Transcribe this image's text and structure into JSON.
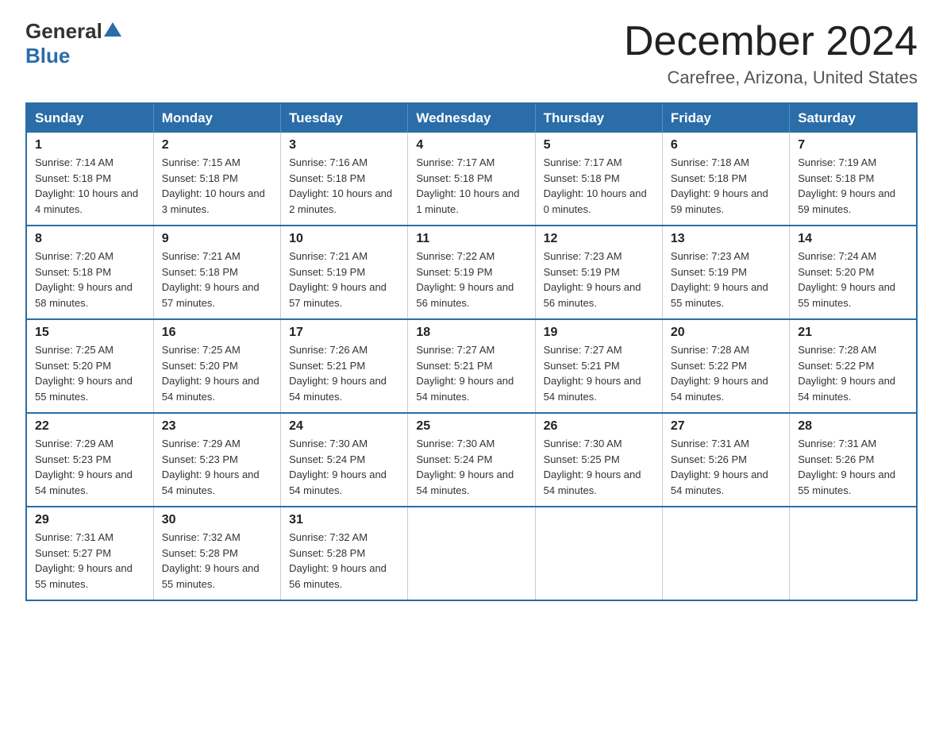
{
  "header": {
    "title": "December 2024",
    "subtitle": "Carefree, Arizona, United States",
    "logo_general": "General",
    "logo_blue": "Blue"
  },
  "weekdays": [
    "Sunday",
    "Monday",
    "Tuesday",
    "Wednesday",
    "Thursday",
    "Friday",
    "Saturday"
  ],
  "weeks": [
    [
      {
        "day": "1",
        "sunrise": "7:14 AM",
        "sunset": "5:18 PM",
        "daylight": "10 hours and 4 minutes."
      },
      {
        "day": "2",
        "sunrise": "7:15 AM",
        "sunset": "5:18 PM",
        "daylight": "10 hours and 3 minutes."
      },
      {
        "day": "3",
        "sunrise": "7:16 AM",
        "sunset": "5:18 PM",
        "daylight": "10 hours and 2 minutes."
      },
      {
        "day": "4",
        "sunrise": "7:17 AM",
        "sunset": "5:18 PM",
        "daylight": "10 hours and 1 minute."
      },
      {
        "day": "5",
        "sunrise": "7:17 AM",
        "sunset": "5:18 PM",
        "daylight": "10 hours and 0 minutes."
      },
      {
        "day": "6",
        "sunrise": "7:18 AM",
        "sunset": "5:18 PM",
        "daylight": "9 hours and 59 minutes."
      },
      {
        "day": "7",
        "sunrise": "7:19 AM",
        "sunset": "5:18 PM",
        "daylight": "9 hours and 59 minutes."
      }
    ],
    [
      {
        "day": "8",
        "sunrise": "7:20 AM",
        "sunset": "5:18 PM",
        "daylight": "9 hours and 58 minutes."
      },
      {
        "day": "9",
        "sunrise": "7:21 AM",
        "sunset": "5:18 PM",
        "daylight": "9 hours and 57 minutes."
      },
      {
        "day": "10",
        "sunrise": "7:21 AM",
        "sunset": "5:19 PM",
        "daylight": "9 hours and 57 minutes."
      },
      {
        "day": "11",
        "sunrise": "7:22 AM",
        "sunset": "5:19 PM",
        "daylight": "9 hours and 56 minutes."
      },
      {
        "day": "12",
        "sunrise": "7:23 AM",
        "sunset": "5:19 PM",
        "daylight": "9 hours and 56 minutes."
      },
      {
        "day": "13",
        "sunrise": "7:23 AM",
        "sunset": "5:19 PM",
        "daylight": "9 hours and 55 minutes."
      },
      {
        "day": "14",
        "sunrise": "7:24 AM",
        "sunset": "5:20 PM",
        "daylight": "9 hours and 55 minutes."
      }
    ],
    [
      {
        "day": "15",
        "sunrise": "7:25 AM",
        "sunset": "5:20 PM",
        "daylight": "9 hours and 55 minutes."
      },
      {
        "day": "16",
        "sunrise": "7:25 AM",
        "sunset": "5:20 PM",
        "daylight": "9 hours and 54 minutes."
      },
      {
        "day": "17",
        "sunrise": "7:26 AM",
        "sunset": "5:21 PM",
        "daylight": "9 hours and 54 minutes."
      },
      {
        "day": "18",
        "sunrise": "7:27 AM",
        "sunset": "5:21 PM",
        "daylight": "9 hours and 54 minutes."
      },
      {
        "day": "19",
        "sunrise": "7:27 AM",
        "sunset": "5:21 PM",
        "daylight": "9 hours and 54 minutes."
      },
      {
        "day": "20",
        "sunrise": "7:28 AM",
        "sunset": "5:22 PM",
        "daylight": "9 hours and 54 minutes."
      },
      {
        "day": "21",
        "sunrise": "7:28 AM",
        "sunset": "5:22 PM",
        "daylight": "9 hours and 54 minutes."
      }
    ],
    [
      {
        "day": "22",
        "sunrise": "7:29 AM",
        "sunset": "5:23 PM",
        "daylight": "9 hours and 54 minutes."
      },
      {
        "day": "23",
        "sunrise": "7:29 AM",
        "sunset": "5:23 PM",
        "daylight": "9 hours and 54 minutes."
      },
      {
        "day": "24",
        "sunrise": "7:30 AM",
        "sunset": "5:24 PM",
        "daylight": "9 hours and 54 minutes."
      },
      {
        "day": "25",
        "sunrise": "7:30 AM",
        "sunset": "5:24 PM",
        "daylight": "9 hours and 54 minutes."
      },
      {
        "day": "26",
        "sunrise": "7:30 AM",
        "sunset": "5:25 PM",
        "daylight": "9 hours and 54 minutes."
      },
      {
        "day": "27",
        "sunrise": "7:31 AM",
        "sunset": "5:26 PM",
        "daylight": "9 hours and 54 minutes."
      },
      {
        "day": "28",
        "sunrise": "7:31 AM",
        "sunset": "5:26 PM",
        "daylight": "9 hours and 55 minutes."
      }
    ],
    [
      {
        "day": "29",
        "sunrise": "7:31 AM",
        "sunset": "5:27 PM",
        "daylight": "9 hours and 55 minutes."
      },
      {
        "day": "30",
        "sunrise": "7:32 AM",
        "sunset": "5:28 PM",
        "daylight": "9 hours and 55 minutes."
      },
      {
        "day": "31",
        "sunrise": "7:32 AM",
        "sunset": "5:28 PM",
        "daylight": "9 hours and 56 minutes."
      },
      null,
      null,
      null,
      null
    ]
  ],
  "labels": {
    "sunrise": "Sunrise:",
    "sunset": "Sunset:",
    "daylight": "Daylight:"
  }
}
